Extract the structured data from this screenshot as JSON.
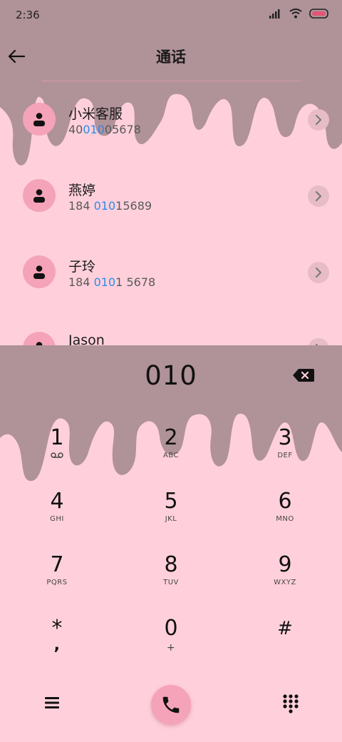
{
  "status_bar": {
    "time": "2:36"
  },
  "header": {
    "title": "通话"
  },
  "contacts": [
    {
      "name": "小米客服",
      "num_pre": "40",
      "num_hl": "010",
      "num_post": "05678"
    },
    {
      "name": "燕婷",
      "num_pre": "184 ",
      "num_hl": "010",
      "num_post": "15689"
    },
    {
      "name": "子玲",
      "num_pre": "184 ",
      "num_hl": "010",
      "num_post": "1 5678"
    },
    {
      "name": "Jason",
      "num_pre": "",
      "num_hl": "",
      "num_post": ""
    }
  ],
  "dialer": {
    "number": "010"
  },
  "keys": [
    {
      "digit": "1",
      "letters": ""
    },
    {
      "digit": "2",
      "letters": "ABC"
    },
    {
      "digit": "3",
      "letters": "DEF"
    },
    {
      "digit": "4",
      "letters": "GHI"
    },
    {
      "digit": "5",
      "letters": "JKL"
    },
    {
      "digit": "6",
      "letters": "MNO"
    },
    {
      "digit": "7",
      "letters": "PQRS"
    },
    {
      "digit": "8",
      "letters": "TUV"
    },
    {
      "digit": "9",
      "letters": "WXYZ"
    },
    {
      "digit": "*",
      "letters": ","
    },
    {
      "digit": "0",
      "letters": "+"
    },
    {
      "digit": "#",
      "letters": ""
    }
  ],
  "icons": {
    "back": "arrow-left-icon",
    "backspace": "backspace-icon",
    "voicemail": "voicemail-icon",
    "menu": "menu-icon",
    "call": "phone-icon",
    "keypad": "dialpad-icon"
  },
  "colors": {
    "background": "#ffd0dc",
    "drip": "#b09299",
    "accent": "#f5a3b8",
    "highlight": "#2f8be6"
  }
}
